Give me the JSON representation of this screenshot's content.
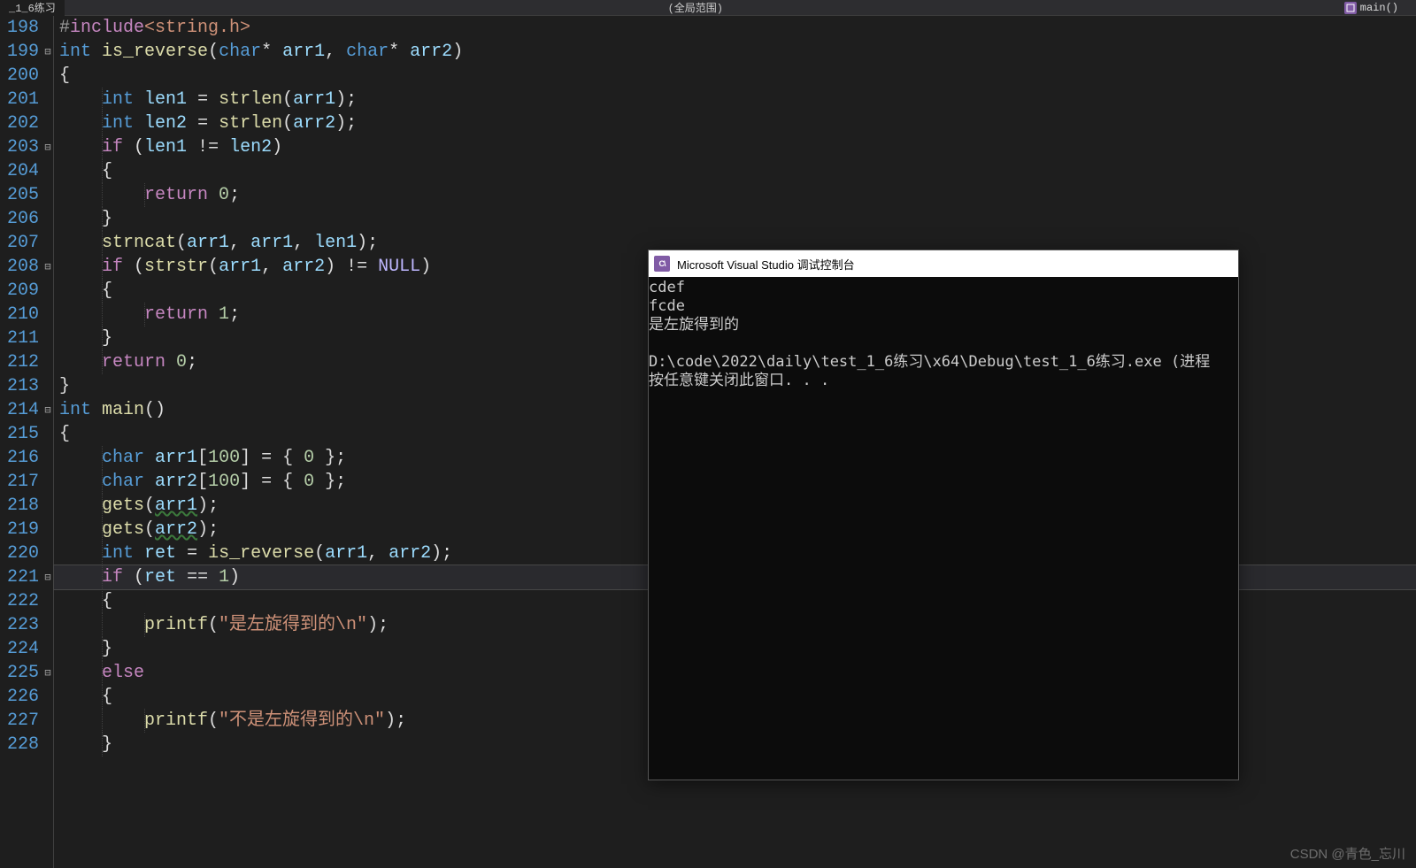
{
  "topbar": {
    "tab_label": "_1_6练习",
    "scope_label": "(全局范围)",
    "func_label": "main()"
  },
  "gutter_start": 198,
  "gutter_count": 31,
  "fold_marks": [
    {
      "row": 1,
      "glyph": "⊟"
    },
    {
      "row": 5,
      "glyph": "⊟"
    },
    {
      "row": 10,
      "glyph": "⊟"
    },
    {
      "row": 16,
      "glyph": "⊟"
    },
    {
      "row": 23,
      "glyph": "⊟"
    },
    {
      "row": 27,
      "glyph": "⊟"
    }
  ],
  "code_lines": [
    [
      {
        "c": "pp",
        "t": "#"
      },
      {
        "c": "ppkw",
        "t": "include"
      },
      {
        "c": "str",
        "t": "<string.h>"
      }
    ],
    [
      {
        "c": "type",
        "t": "int"
      },
      {
        "c": "op",
        "t": " "
      },
      {
        "c": "fn",
        "t": "is_reverse"
      },
      {
        "c": "punc",
        "t": "("
      },
      {
        "c": "type",
        "t": "char"
      },
      {
        "c": "op",
        "t": "* "
      },
      {
        "c": "id",
        "t": "arr1"
      },
      {
        "c": "punc",
        "t": ", "
      },
      {
        "c": "type",
        "t": "char"
      },
      {
        "c": "op",
        "t": "* "
      },
      {
        "c": "id",
        "t": "arr2"
      },
      {
        "c": "punc",
        "t": ")"
      }
    ],
    [
      {
        "c": "punc",
        "t": "{"
      }
    ],
    [
      {
        "c": "op",
        "t": "    "
      },
      {
        "c": "type",
        "t": "int"
      },
      {
        "c": "op",
        "t": " "
      },
      {
        "c": "id",
        "t": "len1"
      },
      {
        "c": "op",
        "t": " = "
      },
      {
        "c": "fn",
        "t": "strlen"
      },
      {
        "c": "punc",
        "t": "("
      },
      {
        "c": "id",
        "t": "arr1"
      },
      {
        "c": "punc",
        "t": ");"
      }
    ],
    [
      {
        "c": "op",
        "t": "    "
      },
      {
        "c": "type",
        "t": "int"
      },
      {
        "c": "op",
        "t": " "
      },
      {
        "c": "id",
        "t": "len2"
      },
      {
        "c": "op",
        "t": " = "
      },
      {
        "c": "fn",
        "t": "strlen"
      },
      {
        "c": "punc",
        "t": "("
      },
      {
        "c": "id",
        "t": "arr2"
      },
      {
        "c": "punc",
        "t": ");"
      }
    ],
    [
      {
        "c": "op",
        "t": "    "
      },
      {
        "c": "kw2",
        "t": "if"
      },
      {
        "c": "op",
        "t": " ("
      },
      {
        "c": "id",
        "t": "len1"
      },
      {
        "c": "op",
        "t": " != "
      },
      {
        "c": "id",
        "t": "len2"
      },
      {
        "c": "punc",
        "t": ")"
      }
    ],
    [
      {
        "c": "op",
        "t": "    "
      },
      {
        "c": "punc",
        "t": "{"
      }
    ],
    [
      {
        "c": "op",
        "t": "        "
      },
      {
        "c": "kw2",
        "t": "return"
      },
      {
        "c": "op",
        "t": " "
      },
      {
        "c": "num",
        "t": "0"
      },
      {
        "c": "punc",
        "t": ";"
      }
    ],
    [
      {
        "c": "op",
        "t": "    "
      },
      {
        "c": "punc",
        "t": "}"
      }
    ],
    [
      {
        "c": "op",
        "t": "    "
      },
      {
        "c": "fn",
        "t": "strncat"
      },
      {
        "c": "punc",
        "t": "("
      },
      {
        "c": "id",
        "t": "arr1"
      },
      {
        "c": "punc",
        "t": ", "
      },
      {
        "c": "id",
        "t": "arr1"
      },
      {
        "c": "punc",
        "t": ", "
      },
      {
        "c": "id",
        "t": "len1"
      },
      {
        "c": "punc",
        "t": ");"
      }
    ],
    [
      {
        "c": "op",
        "t": "    "
      },
      {
        "c": "kw2",
        "t": "if"
      },
      {
        "c": "op",
        "t": " ("
      },
      {
        "c": "fn",
        "t": "strstr"
      },
      {
        "c": "punc",
        "t": "("
      },
      {
        "c": "id",
        "t": "arr1"
      },
      {
        "c": "punc",
        "t": ", "
      },
      {
        "c": "id",
        "t": "arr2"
      },
      {
        "c": "punc",
        "t": ")"
      },
      {
        "c": "op",
        "t": " != "
      },
      {
        "c": "mac",
        "t": "NULL"
      },
      {
        "c": "punc",
        "t": ")"
      }
    ],
    [
      {
        "c": "op",
        "t": "    "
      },
      {
        "c": "punc",
        "t": "{"
      }
    ],
    [
      {
        "c": "op",
        "t": "        "
      },
      {
        "c": "kw2",
        "t": "return"
      },
      {
        "c": "op",
        "t": " "
      },
      {
        "c": "num",
        "t": "1"
      },
      {
        "c": "punc",
        "t": ";"
      }
    ],
    [
      {
        "c": "op",
        "t": "    "
      },
      {
        "c": "punc",
        "t": "}"
      }
    ],
    [
      {
        "c": "op",
        "t": "    "
      },
      {
        "c": "kw2",
        "t": "return"
      },
      {
        "c": "op",
        "t": " "
      },
      {
        "c": "num",
        "t": "0"
      },
      {
        "c": "punc",
        "t": ";"
      }
    ],
    [
      {
        "c": "punc",
        "t": "}"
      }
    ],
    [
      {
        "c": "type",
        "t": "int"
      },
      {
        "c": "op",
        "t": " "
      },
      {
        "c": "fn",
        "t": "main"
      },
      {
        "c": "punc",
        "t": "()"
      }
    ],
    [
      {
        "c": "punc",
        "t": "{"
      }
    ],
    [
      {
        "c": "op",
        "t": "    "
      },
      {
        "c": "type",
        "t": "char"
      },
      {
        "c": "op",
        "t": " "
      },
      {
        "c": "id",
        "t": "arr1"
      },
      {
        "c": "punc",
        "t": "["
      },
      {
        "c": "num",
        "t": "100"
      },
      {
        "c": "punc",
        "t": "]"
      },
      {
        "c": "op",
        "t": " = { "
      },
      {
        "c": "num",
        "t": "0"
      },
      {
        "c": "op",
        "t": " };"
      }
    ],
    [
      {
        "c": "op",
        "t": "    "
      },
      {
        "c": "type",
        "t": "char"
      },
      {
        "c": "op",
        "t": " "
      },
      {
        "c": "id",
        "t": "arr2"
      },
      {
        "c": "punc",
        "t": "["
      },
      {
        "c": "num",
        "t": "100"
      },
      {
        "c": "punc",
        "t": "]"
      },
      {
        "c": "op",
        "t": " = { "
      },
      {
        "c": "num",
        "t": "0"
      },
      {
        "c": "op",
        "t": " };"
      }
    ],
    [
      {
        "c": "op",
        "t": "    "
      },
      {
        "c": "fn",
        "t": "gets"
      },
      {
        "c": "punc",
        "t": "("
      },
      {
        "c": "idg",
        "t": "arr1"
      },
      {
        "c": "punc",
        "t": ");"
      }
    ],
    [
      {
        "c": "op",
        "t": "    "
      },
      {
        "c": "fn",
        "t": "gets"
      },
      {
        "c": "punc",
        "t": "("
      },
      {
        "c": "idg",
        "t": "arr2"
      },
      {
        "c": "punc",
        "t": ");"
      }
    ],
    [
      {
        "c": "op",
        "t": "    "
      },
      {
        "c": "type",
        "t": "int"
      },
      {
        "c": "op",
        "t": " "
      },
      {
        "c": "id",
        "t": "ret"
      },
      {
        "c": "op",
        "t": " = "
      },
      {
        "c": "fn",
        "t": "is_reverse"
      },
      {
        "c": "punc",
        "t": "("
      },
      {
        "c": "id",
        "t": "arr1"
      },
      {
        "c": "punc",
        "t": ", "
      },
      {
        "c": "id",
        "t": "arr2"
      },
      {
        "c": "punc",
        "t": ");"
      }
    ],
    [
      {
        "c": "op",
        "t": "    "
      },
      {
        "c": "kw2",
        "t": "if"
      },
      {
        "c": "op",
        "t": " ("
      },
      {
        "c": "id",
        "t": "ret"
      },
      {
        "c": "op",
        "t": " == "
      },
      {
        "c": "num",
        "t": "1"
      },
      {
        "c": "punc",
        "t": ")"
      }
    ],
    [
      {
        "c": "op",
        "t": "    "
      },
      {
        "c": "punc",
        "t": "{"
      }
    ],
    [
      {
        "c": "op",
        "t": "        "
      },
      {
        "c": "fn",
        "t": "printf"
      },
      {
        "c": "punc",
        "t": "("
      },
      {
        "c": "str",
        "t": "\"是左旋得到的\\n\""
      },
      {
        "c": "punc",
        "t": ");"
      }
    ],
    [
      {
        "c": "op",
        "t": "    "
      },
      {
        "c": "punc",
        "t": "}"
      }
    ],
    [
      {
        "c": "op",
        "t": "    "
      },
      {
        "c": "kw2",
        "t": "else"
      }
    ],
    [
      {
        "c": "op",
        "t": "    "
      },
      {
        "c": "punc",
        "t": "{"
      }
    ],
    [
      {
        "c": "op",
        "t": "        "
      },
      {
        "c": "fn",
        "t": "printf"
      },
      {
        "c": "punc",
        "t": "("
      },
      {
        "c": "str",
        "t": "\"不是左旋得到的\\n\""
      },
      {
        "c": "punc",
        "t": ");"
      }
    ],
    [
      {
        "c": "op",
        "t": "    "
      },
      {
        "c": "punc",
        "t": "}"
      }
    ]
  ],
  "highlight_row": 23,
  "console": {
    "title": "Microsoft Visual Studio 调试控制台",
    "lines": [
      "cdef",
      "fcde",
      "是左旋得到的",
      "",
      "D:\\code\\2022\\daily\\test_1_6练习\\x64\\Debug\\test_1_6练习.exe (进程",
      "按任意键关闭此窗口. . ."
    ]
  },
  "watermark": "CSDN @青色_忘川"
}
